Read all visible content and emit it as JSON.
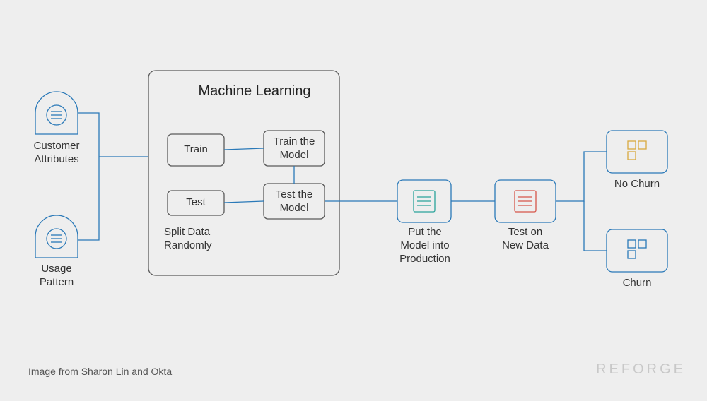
{
  "diagram": {
    "title": "Machine Learning",
    "inputs": {
      "customer": "Customer\nAttributes",
      "usage": "Usage\nPattern"
    },
    "split_caption": "Split Data\nRandomly",
    "nodes": {
      "train": "Train",
      "test": "Test",
      "train_model": "Train the\nModel",
      "test_model": "Test the\nModel",
      "production": "Put the\nModel into\nProduction",
      "test_new": "Test on\nNew Data",
      "no_churn": "No Churn",
      "churn": "Churn"
    },
    "caption": "Image from Sharon Lin and Okta",
    "watermark": "REFORGE"
  }
}
